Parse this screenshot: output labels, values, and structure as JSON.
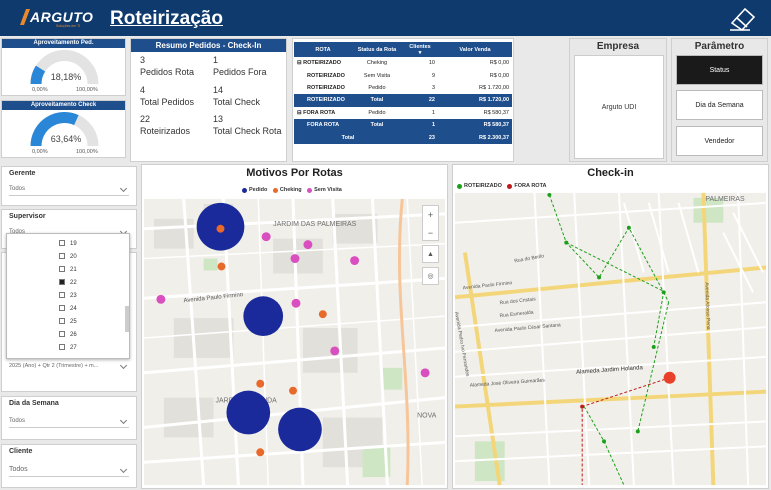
{
  "header": {
    "logo_text": "ARGUTO",
    "logo_sub": "Soluções em TI",
    "title": "Roteirização",
    "eraser_icon": "eraser-icon"
  },
  "gauges": [
    {
      "title": "Aproveitamento Ped.",
      "value": "18,18%",
      "fraction": 0.1818,
      "min": "0,00%",
      "max": "100,00%"
    },
    {
      "title": "Aproveitamento Check",
      "value": "63,64%",
      "fraction": 0.6364,
      "min": "0,00%",
      "max": "100,00%"
    }
  ],
  "kpi": {
    "title": "Resumo Pedidos - Check-In",
    "items": [
      {
        "value": "3",
        "label": "Pedidos Rota"
      },
      {
        "value": "1",
        "label": "Pedidos Fora"
      },
      {
        "value": "4",
        "label": "Total Pedidos"
      },
      {
        "value": "14",
        "label": "Total Check"
      },
      {
        "value": "22",
        "label": "Roteirizados"
      },
      {
        "value": "13",
        "label": "Total Check Rota"
      }
    ]
  },
  "table": {
    "headers": [
      "ROTA",
      "Status da Rota",
      "Clientes",
      "Valor Venda"
    ],
    "rows": [
      {
        "expand": "⊟",
        "rota": "ROTEIRIZADO",
        "status": "Cheking",
        "clientes": "10",
        "valor": "R$ 0,00",
        "subtotal": false
      },
      {
        "expand": "",
        "rota": "ROTEIRIZADO",
        "status": "Sem Visita",
        "clientes": "9",
        "valor": "R$ 0,00",
        "subtotal": false
      },
      {
        "expand": "",
        "rota": "ROTEIRIZADO",
        "status": "Pedido",
        "clientes": "3",
        "valor": "R$ 1.720,00",
        "subtotal": false
      },
      {
        "expand": "",
        "rota": "ROTEIRIZADO",
        "status": "Total",
        "clientes": "22",
        "valor": "R$ 1.720,00",
        "subtotal": true
      },
      {
        "expand": "⊟",
        "rota": "FORA ROTA",
        "status": "Pedido",
        "clientes": "1",
        "valor": "R$ 580,37",
        "subtotal": false
      },
      {
        "expand": "",
        "rota": "FORA ROTA",
        "status": "Total",
        "clientes": "1",
        "valor": "R$ 580,37",
        "subtotal": true
      },
      {
        "expand": "",
        "rota": "Total",
        "status": "",
        "clientes": "23",
        "valor": "R$ 2.300,37",
        "subtotal": true
      }
    ]
  },
  "empresa": {
    "label": "Empresa",
    "value": "Arguto UDI"
  },
  "parametro": {
    "label": "Parâmetro",
    "options": [
      "Status",
      "Dia da Semana",
      "Vendedor"
    ],
    "active": "Status"
  },
  "slicers": {
    "gerente": {
      "label": "Gerente",
      "value": "Todos"
    },
    "supervisor": {
      "label": "Supervisor",
      "value": "Todos"
    },
    "date_value": "2025 (Ano) + Qtr 2 (Trimestre) + m...",
    "dia_semana": {
      "label": "Dia da Semana",
      "value": "Todos"
    },
    "cliente": {
      "label": "Cliente",
      "value": "Todos"
    }
  },
  "day_list": [
    {
      "day": "19",
      "checked": false
    },
    {
      "day": "20",
      "checked": false
    },
    {
      "day": "21",
      "checked": false
    },
    {
      "day": "22",
      "checked": true
    },
    {
      "day": "23",
      "checked": false
    },
    {
      "day": "24",
      "checked": false
    },
    {
      "day": "25",
      "checked": false
    },
    {
      "day": "26",
      "checked": false
    },
    {
      "day": "27",
      "checked": false
    }
  ],
  "map1": {
    "title": "Motivos Por Rotas",
    "legend": [
      "Pedido",
      "Cheking",
      "Sem Visita"
    ],
    "colors": {
      "pedido": "#1a2a9a",
      "cheking": "#e8692a",
      "sem_visita": "#d94fc0"
    },
    "labels": [
      "JARDIM DAS PALMEIRAS",
      "Avenida Paulo Firmino",
      "JARDIM HOLANDA",
      "NOVA"
    ]
  },
  "map2": {
    "title": "Check-in",
    "legend": [
      "ROTEIRIZADO",
      "FORA ROTA"
    ],
    "colors": {
      "roteirizado": "#1aa01a",
      "fora_rota": "#c0191a"
    },
    "labels": [
      "PALMEIRAS",
      "Avenida Paulo Firmino",
      "Alameda Jardim Holanda",
      "Avenida Paulo César Santana",
      "Alameda José Oliveira Guimarães",
      "Rua dos Cristais",
      "Rua Esmeralda",
      "Avenida Pedro Ivo Fernandes",
      "Avenida Afonso Pena",
      "Rua do Berilo"
    ]
  }
}
